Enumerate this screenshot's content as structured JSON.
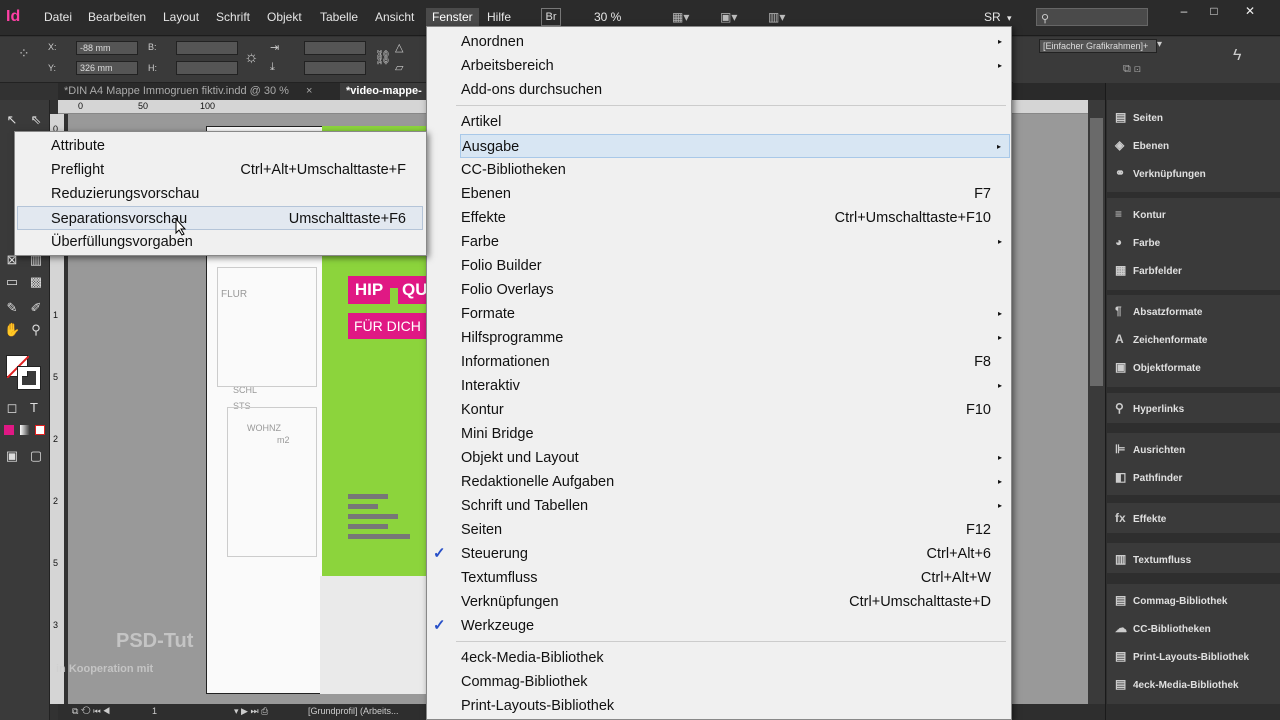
{
  "app": {
    "logo": "Id"
  },
  "menubar": {
    "items": [
      "Datei",
      "Bearbeiten",
      "Layout",
      "Schrift",
      "Objekt",
      "Tabelle",
      "Ansicht",
      "Fenster",
      "Hilfe"
    ],
    "bridge_label": "Br",
    "zoom": "30 %",
    "workspace": "SR",
    "window_buttons": [
      "–",
      "□",
      "✕"
    ]
  },
  "control": {
    "x_label": "X:",
    "x_value": "-88 mm",
    "y_label": "Y:",
    "y_value": "326 mm",
    "b_label": "B:",
    "h_label": "H:",
    "frame_style": "[Einfacher Grafikrahmen]+"
  },
  "tabs": [
    {
      "label": "*DIN A4 Mappe Immogruen fiktiv.indd @ 30 %",
      "close": "×"
    },
    {
      "label": "*video-mappe-"
    }
  ],
  "ruler": {
    "top": [
      "0",
      "50",
      "100"
    ],
    "left": [
      "0",
      "5",
      "1",
      "1",
      "5",
      "2",
      "2",
      "5",
      "3"
    ]
  },
  "page_content": {
    "hip": "HIP",
    "qu": "QU",
    "fur_dich": "FÜR DICH",
    "sketch_texts": [
      "FLUR",
      "SCHL",
      "STS",
      "WOHNZ",
      "m2"
    ]
  },
  "statusbar": {
    "page": "1",
    "profile": "[Grundprofil] (Arbeits..."
  },
  "fenster_menu": {
    "items": [
      {
        "label": "Anordnen",
        "submenu": true
      },
      {
        "label": "Arbeitsbereich",
        "submenu": true
      },
      {
        "label": "Add-ons durchsuchen"
      },
      {
        "sep": true
      },
      {
        "label": "Artikel"
      },
      {
        "label": "Ausgabe",
        "submenu": true,
        "highlight": true
      },
      {
        "label": "CC-Bibliotheken"
      },
      {
        "label": "Ebenen",
        "shortcut": "F7"
      },
      {
        "label": "Effekte",
        "shortcut": "Ctrl+Umschalttaste+F10"
      },
      {
        "label": "Farbe",
        "submenu": true
      },
      {
        "label": "Folio Builder"
      },
      {
        "label": "Folio Overlays"
      },
      {
        "label": "Formate",
        "submenu": true
      },
      {
        "label": "Hilfsprogramme",
        "submenu": true
      },
      {
        "label": "Informationen",
        "shortcut": "F8"
      },
      {
        "label": "Interaktiv",
        "submenu": true
      },
      {
        "label": "Kontur",
        "shortcut": "F10"
      },
      {
        "label": "Mini Bridge"
      },
      {
        "label": "Objekt und Layout",
        "submenu": true
      },
      {
        "label": "Redaktionelle Aufgaben",
        "submenu": true
      },
      {
        "label": "Schrift und Tabellen",
        "submenu": true
      },
      {
        "label": "Seiten",
        "shortcut": "F12"
      },
      {
        "label": "Steuerung",
        "shortcut": "Ctrl+Alt+6",
        "checked": true
      },
      {
        "label": "Textumfluss",
        "shortcut": "Ctrl+Alt+W"
      },
      {
        "label": "Verknüpfungen",
        "shortcut": "Ctrl+Umschalttaste+D"
      },
      {
        "label": "Werkzeuge",
        "checked": true
      },
      {
        "sep": true
      },
      {
        "label": "4eck-Media-Bibliothek"
      },
      {
        "label": "Commag-Bibliothek"
      },
      {
        "label": "Print-Layouts-Bibliothek"
      }
    ],
    "submenu_arrow": "▸",
    "check_mark": "✓"
  },
  "ausgabe_submenu": {
    "items": [
      {
        "label": "Attribute"
      },
      {
        "label": "Preflight",
        "shortcut": "Ctrl+Alt+Umschalttaste+F"
      },
      {
        "label": "Reduzierungsvorschau"
      },
      {
        "label": "Separationsvorschau",
        "shortcut": "Umschalttaste+F6",
        "highlight": true
      },
      {
        "label": "Überfüllungsvorgaben"
      }
    ]
  },
  "panels": {
    "groups": [
      [
        {
          "label": "Seiten",
          "icon": "pages-icon",
          "glyph": "▤"
        },
        {
          "label": "Ebenen",
          "icon": "layers-icon",
          "glyph": "◈"
        },
        {
          "label": "Verknüpfungen",
          "icon": "links-icon",
          "glyph": "⚭"
        }
      ],
      [
        {
          "label": "Kontur",
          "icon": "stroke-icon",
          "glyph": "≡"
        },
        {
          "label": "Farbe",
          "icon": "color-icon",
          "glyph": "◕"
        },
        {
          "label": "Farbfelder",
          "icon": "swatches-icon",
          "glyph": "▦"
        }
      ],
      [
        {
          "label": "Absatzformate",
          "icon": "paragraph-styles-icon",
          "glyph": "¶"
        },
        {
          "label": "Zeichenformate",
          "icon": "character-styles-icon",
          "glyph": "A"
        },
        {
          "label": "Objektformate",
          "icon": "object-styles-icon",
          "glyph": "▣"
        }
      ],
      [
        {
          "label": "Hyperlinks",
          "icon": "hyperlinks-icon",
          "glyph": "⚲"
        }
      ],
      [
        {
          "label": "Ausrichten",
          "icon": "align-icon",
          "glyph": "⊫"
        },
        {
          "label": "Pathfinder",
          "icon": "pathfinder-icon",
          "glyph": "◧"
        }
      ],
      [
        {
          "label": "Effekte",
          "icon": "effects-icon",
          "glyph": "fx"
        }
      ],
      [
        {
          "label": "Textumfluss",
          "icon": "text-wrap-icon",
          "glyph": "▥"
        }
      ],
      [
        {
          "label": "Commag-Bibliothek",
          "icon": "library-icon",
          "glyph": "▤"
        },
        {
          "label": "CC-Bibliotheken",
          "icon": "cc-libraries-icon",
          "glyph": "☁"
        },
        {
          "label": "Print-Layouts-Bibliothek",
          "icon": "library-icon",
          "glyph": "▤"
        },
        {
          "label": "4eck-Media-Bibliothek",
          "icon": "library-icon",
          "glyph": "▤"
        }
      ]
    ]
  },
  "watermark": {
    "title": "PSD-Tut",
    "subtitle": "in Kooperation mit"
  }
}
